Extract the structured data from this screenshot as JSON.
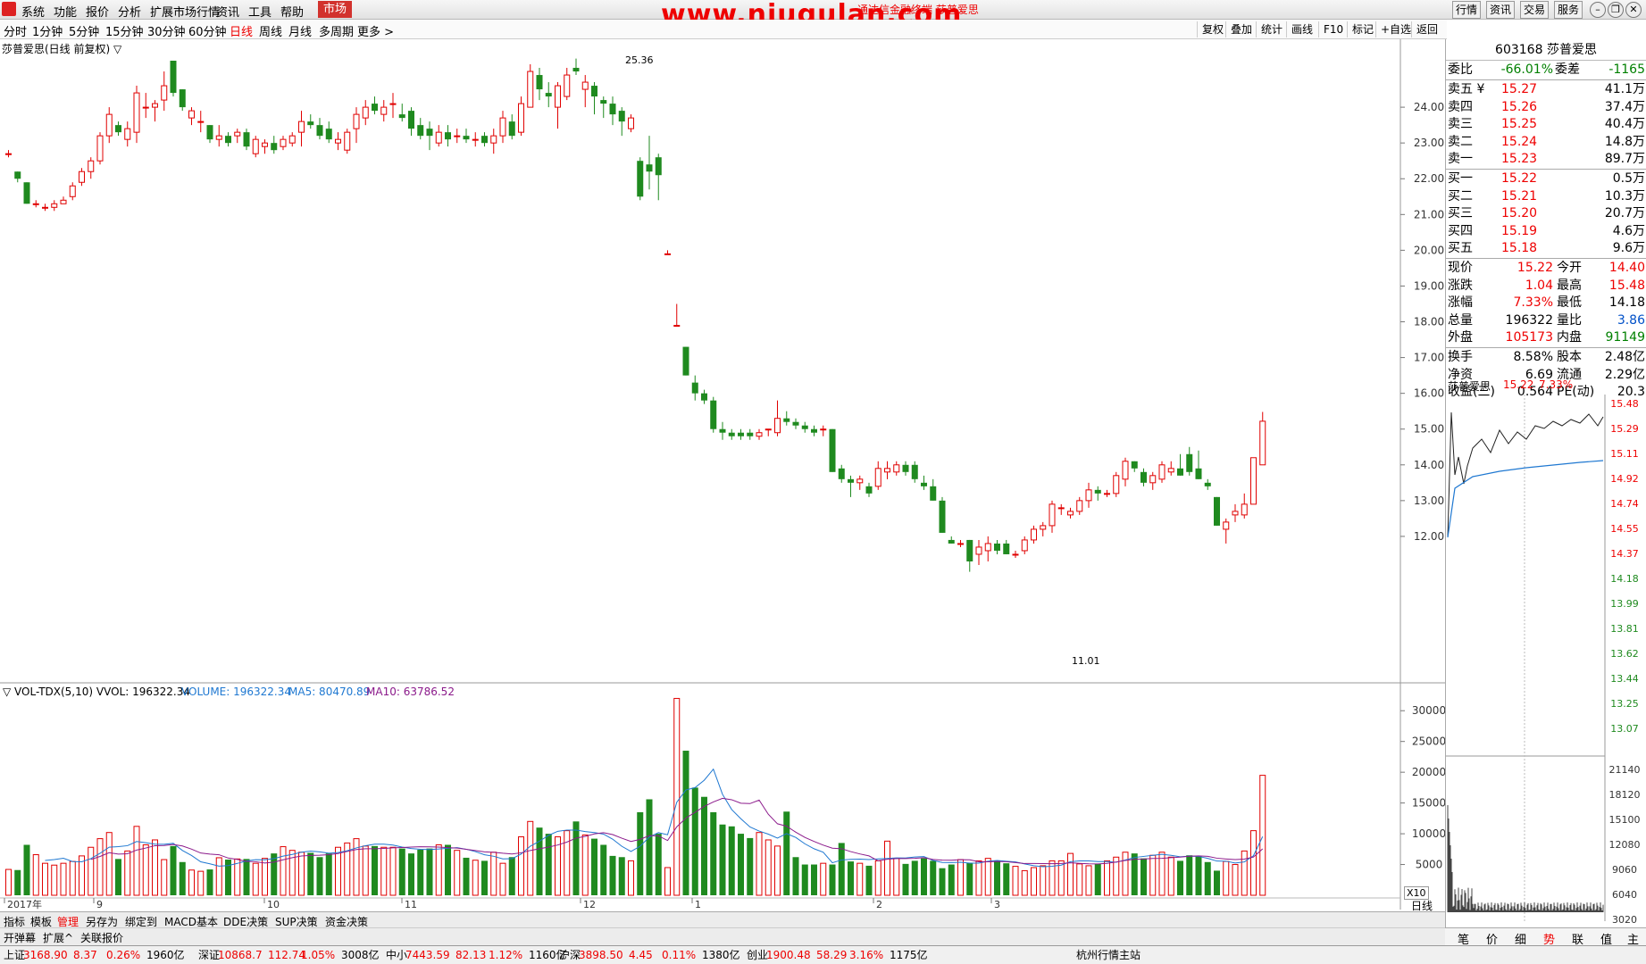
{
  "menu": [
    "系统",
    "功能",
    "报价",
    "分析",
    "扩展市场行情",
    "资讯",
    "工具",
    "帮助",
    "市场"
  ],
  "watermark": "www.niugulan.com",
  "title_partial": "通达信金融终端 莎普爱思",
  "right_buttons": [
    "行情",
    "资讯",
    "交易",
    "服务"
  ],
  "periods": [
    "分时",
    "1分钟",
    "5分钟",
    "15分钟",
    "30分钟",
    "60分钟",
    "日线",
    "周线",
    "月线",
    "多周期",
    "更多 >"
  ],
  "chart_tools": [
    "复权",
    "叠加",
    "统计",
    "画线",
    "F10",
    "标记",
    "+自选",
    "返回"
  ],
  "chart_title": "莎普爱思(日线 前复权) ▽",
  "vol_title": "▽ VOL-TDX(5,10) VVOL: 196322.34",
  "vol_legend": {
    "volume": "VOLUME: 196322.34",
    "ma5": "MA5: 80470.89",
    "ma10": "MA10: 63786.52"
  },
  "high_label": "25.36",
  "low_label": "11.01",
  "price_axis": [
    "24.00",
    "23.00",
    "22.00",
    "21.00",
    "20.00",
    "19.00",
    "18.00",
    "17.00",
    "16.00",
    "15.00",
    "14.00",
    "13.00",
    "12.00"
  ],
  "vol_axis": [
    "30000",
    "25000",
    "20000",
    "15000",
    "10000",
    "5000"
  ],
  "vol_unit": "X10",
  "date_axis": [
    {
      "label": "2017年",
      "x": 5
    },
    {
      "label": "9",
      "x": 105
    },
    {
      "label": "10",
      "x": 296
    },
    {
      "label": "11",
      "x": 450
    },
    {
      "label": "12",
      "x": 650
    },
    {
      "label": "1",
      "x": 775
    },
    {
      "label": "2",
      "x": 978
    },
    {
      "label": "3",
      "x": 1110
    }
  ],
  "period_label": "日线",
  "chart_data": {
    "type": "candlestick",
    "candles": [
      [
        22.7,
        22.8,
        22.6,
        22.7
      ],
      [
        22.2,
        22.2,
        21.9,
        22.0
      ],
      [
        21.9,
        21.9,
        21.3,
        21.3
      ],
      [
        21.3,
        21.4,
        21.2,
        21.3
      ],
      [
        21.2,
        21.3,
        21.1,
        21.2
      ],
      [
        21.2,
        21.4,
        21.1,
        21.3
      ],
      [
        21.3,
        21.5,
        21.3,
        21.4
      ],
      [
        21.5,
        21.9,
        21.4,
        21.8
      ],
      [
        21.9,
        22.3,
        21.8,
        22.2
      ],
      [
        22.2,
        22.6,
        22.0,
        22.5
      ],
      [
        22.5,
        23.3,
        22.4,
        23.2
      ],
      [
        23.2,
        24.0,
        23.0,
        23.8
      ],
      [
        23.5,
        23.6,
        23.2,
        23.3
      ],
      [
        23.1,
        23.6,
        22.9,
        23.4
      ],
      [
        23.3,
        24.6,
        23.0,
        24.4
      ],
      [
        24.0,
        24.4,
        23.7,
        24.0
      ],
      [
        24.0,
        24.2,
        23.6,
        24.1
      ],
      [
        24.2,
        25.0,
        23.9,
        24.6
      ],
      [
        25.3,
        25.3,
        24.3,
        24.4
      ],
      [
        24.5,
        24.5,
        23.9,
        24.0
      ],
      [
        23.7,
        24.0,
        23.5,
        23.9
      ],
      [
        23.6,
        23.9,
        23.3,
        23.6
      ],
      [
        23.5,
        23.5,
        23.0,
        23.1
      ],
      [
        23.1,
        23.5,
        22.9,
        23.2
      ],
      [
        23.2,
        23.3,
        22.9,
        23.0
      ],
      [
        23.2,
        23.4,
        23.0,
        23.3
      ],
      [
        23.3,
        23.4,
        22.8,
        22.9
      ],
      [
        22.7,
        23.2,
        22.6,
        23.1
      ],
      [
        22.9,
        23.1,
        22.7,
        23.0
      ],
      [
        23.0,
        23.2,
        22.7,
        22.8
      ],
      [
        22.9,
        23.2,
        22.8,
        23.1
      ],
      [
        23.0,
        23.3,
        22.9,
        23.2
      ],
      [
        23.3,
        23.9,
        22.9,
        23.6
      ],
      [
        23.6,
        23.8,
        23.4,
        23.5
      ],
      [
        23.5,
        23.7,
        23.1,
        23.2
      ],
      [
        23.4,
        23.6,
        23.0,
        23.1
      ],
      [
        23.0,
        23.3,
        22.8,
        23.1
      ],
      [
        22.8,
        23.4,
        22.7,
        23.3
      ],
      [
        23.4,
        24.0,
        23.0,
        23.8
      ],
      [
        23.7,
        24.2,
        23.5,
        24.0
      ],
      [
        24.1,
        24.3,
        23.8,
        23.9
      ],
      [
        23.8,
        24.2,
        23.6,
        24.0
      ],
      [
        24.1,
        24.4,
        23.7,
        24.1
      ],
      [
        23.8,
        24.1,
        23.6,
        23.7
      ],
      [
        23.9,
        24.0,
        23.2,
        23.4
      ],
      [
        23.5,
        23.7,
        23.1,
        23.2
      ],
      [
        23.4,
        23.6,
        22.8,
        23.2
      ],
      [
        23.0,
        23.5,
        22.9,
        23.3
      ],
      [
        23.3,
        23.5,
        22.9,
        23.1
      ],
      [
        23.2,
        23.4,
        23.0,
        23.2
      ],
      [
        23.2,
        23.4,
        23.0,
        23.1
      ],
      [
        23.1,
        23.3,
        22.9,
        23.1
      ],
      [
        23.2,
        23.3,
        22.9,
        23.0
      ],
      [
        23.0,
        23.4,
        22.7,
        23.2
      ],
      [
        23.2,
        23.9,
        23.0,
        23.7
      ],
      [
        23.6,
        23.8,
        23.1,
        23.2
      ],
      [
        23.3,
        24.3,
        23.2,
        24.1
      ],
      [
        24.0,
        25.2,
        24.0,
        25.0
      ],
      [
        24.9,
        25.1,
        24.2,
        24.5
      ],
      [
        24.4,
        24.7,
        24.0,
        24.3
      ],
      [
        24.0,
        24.7,
        23.4,
        24.6
      ],
      [
        24.3,
        25.1,
        24.2,
        24.9
      ],
      [
        25.1,
        25.36,
        24.9,
        25.0
      ],
      [
        24.5,
        24.9,
        24.0,
        24.7
      ],
      [
        24.6,
        24.7,
        23.8,
        24.3
      ],
      [
        24.2,
        24.3,
        23.7,
        24.1
      ],
      [
        24.1,
        24.3,
        23.5,
        23.8
      ],
      [
        23.9,
        24.0,
        23.2,
        23.6
      ],
      [
        23.4,
        23.8,
        23.3,
        23.7
      ],
      [
        22.5,
        22.6,
        21.4,
        21.5
      ],
      [
        22.4,
        23.2,
        21.7,
        22.2
      ],
      [
        22.6,
        22.7,
        21.4,
        22.1
      ],
      [
        19.9,
        20.0,
        19.9,
        19.9
      ],
      [
        17.9,
        18.5,
        17.9,
        17.9
      ],
      [
        17.3,
        17.3,
        16.5,
        16.5
      ],
      [
        16.3,
        16.5,
        15.8,
        16.0
      ],
      [
        16.0,
        16.1,
        15.7,
        15.8
      ],
      [
        15.8,
        15.9,
        14.9,
        15.0
      ],
      [
        15.0,
        15.2,
        14.7,
        14.9
      ],
      [
        14.9,
        15.0,
        14.7,
        14.8
      ],
      [
        14.9,
        15.0,
        14.7,
        14.8
      ],
      [
        14.9,
        15.0,
        14.7,
        14.8
      ],
      [
        14.8,
        15.0,
        14.7,
        14.9
      ],
      [
        15.0,
        15.0,
        14.8,
        15.0
      ],
      [
        14.9,
        15.8,
        14.8,
        15.3
      ],
      [
        15.3,
        15.5,
        15.1,
        15.2
      ],
      [
        15.2,
        15.3,
        15.0,
        15.1
      ],
      [
        15.1,
        15.2,
        14.9,
        15.0
      ],
      [
        15.0,
        15.1,
        14.8,
        14.9
      ],
      [
        15.0,
        15.1,
        14.8,
        15.0
      ],
      [
        15.0,
        15.0,
        13.8,
        13.8
      ],
      [
        13.9,
        14.0,
        13.5,
        13.6
      ],
      [
        13.6,
        13.7,
        13.1,
        13.5
      ],
      [
        13.5,
        13.7,
        13.3,
        13.6
      ],
      [
        13.4,
        13.5,
        13.1,
        13.2
      ],
      [
        13.4,
        14.1,
        13.3,
        13.9
      ],
      [
        13.8,
        14.1,
        13.6,
        13.9
      ],
      [
        13.8,
        14.1,
        13.7,
        14.0
      ],
      [
        14.0,
        14.1,
        13.7,
        13.8
      ],
      [
        14.0,
        14.1,
        13.5,
        13.6
      ],
      [
        13.5,
        13.7,
        13.3,
        13.4
      ],
      [
        13.4,
        13.6,
        13.0,
        13.0
      ],
      [
        13.0,
        13.1,
        12.1,
        12.1
      ],
      [
        11.9,
        12.0,
        11.8,
        11.8
      ],
      [
        11.8,
        11.9,
        11.7,
        11.8
      ],
      [
        11.9,
        11.9,
        11.01,
        11.3
      ],
      [
        11.5,
        11.9,
        11.2,
        11.7
      ],
      [
        11.6,
        12.0,
        11.3,
        11.8
      ],
      [
        11.8,
        11.9,
        11.5,
        11.6
      ],
      [
        11.8,
        11.9,
        11.5,
        11.5
      ],
      [
        11.5,
        11.6,
        11.4,
        11.5
      ],
      [
        11.6,
        12.0,
        11.5,
        11.9
      ],
      [
        11.9,
        12.3,
        11.8,
        12.2
      ],
      [
        12.2,
        12.4,
        12.0,
        12.3
      ],
      [
        12.3,
        13.0,
        12.1,
        12.9
      ],
      [
        12.8,
        12.9,
        12.6,
        12.8
      ],
      [
        12.6,
        12.8,
        12.5,
        12.7
      ],
      [
        12.7,
        13.1,
        12.6,
        13.0
      ],
      [
        13.0,
        13.5,
        12.8,
        13.3
      ],
      [
        13.3,
        13.4,
        13.0,
        13.2
      ],
      [
        13.2,
        13.3,
        13.1,
        13.2
      ],
      [
        13.2,
        13.8,
        13.1,
        13.7
      ],
      [
        13.6,
        14.2,
        13.4,
        14.1
      ],
      [
        14.1,
        14.1,
        13.8,
        13.9
      ],
      [
        13.8,
        13.9,
        13.4,
        13.5
      ],
      [
        13.5,
        13.8,
        13.3,
        13.7
      ],
      [
        13.6,
        14.1,
        13.5,
        14.0
      ],
      [
        13.8,
        14.1,
        13.7,
        13.9
      ],
      [
        13.9,
        14.3,
        13.7,
        13.7
      ],
      [
        14.3,
        14.5,
        13.7,
        13.8
      ],
      [
        13.9,
        14.4,
        13.6,
        13.6
      ],
      [
        13.5,
        13.6,
        13.3,
        13.4
      ],
      [
        13.1,
        13.1,
        12.3,
        12.3
      ],
      [
        12.2,
        12.5,
        11.8,
        12.4
      ],
      [
        12.6,
        12.9,
        12.4,
        12.7
      ],
      [
        12.6,
        13.2,
        12.5,
        12.9
      ],
      [
        12.9,
        14.2,
        12.9,
        14.2
      ],
      [
        14.0,
        15.48,
        14.0,
        15.22
      ]
    ],
    "volume": [
      420,
      410,
      820,
      660,
      520,
      490,
      520,
      550,
      640,
      780,
      920,
      1020,
      590,
      720,
      1120,
      820,
      900,
      580,
      800,
      540,
      410,
      390,
      420,
      610,
      580,
      590,
      590,
      520,
      600,
      680,
      790,
      730,
      700,
      690,
      620,
      680,
      780,
      850,
      920,
      800,
      800,
      780,
      780,
      760,
      680,
      740,
      760,
      820,
      820,
      730,
      610,
      570,
      560,
      700,
      520,
      620,
      950,
      1200,
      1100,
      1000,
      950,
      1050,
      1200,
      980,
      920,
      820,
      640,
      620,
      560,
      1350,
      1560,
      1000,
      450,
      3200,
      2350,
      1750,
      1600,
      1350,
      1150,
      1120,
      1000,
      930,
      1020,
      900,
      800,
      1360,
      620,
      500,
      500,
      520,
      500,
      850,
      550,
      520,
      480,
      560,
      880,
      600,
      510,
      560,
      600,
      560,
      440,
      500,
      580,
      530,
      560,
      600,
      560,
      520,
      470,
      400,
      450,
      480,
      560,
      560,
      680,
      510,
      480,
      510,
      560,
      620,
      700,
      680,
      600,
      650,
      700,
      620,
      560,
      650,
      630,
      540,
      400,
      550,
      500,
      720,
      1050,
      1950
    ],
    "xlim": [
      "2017年",
      "3"
    ],
    "price_range": [
      11.01,
      25.36
    ]
  },
  "quote": {
    "code_name": "603168 莎普爱思",
    "weibi_label": "委比",
    "weibi": "-66.01%",
    "weicha_label": "委差",
    "weicha": "-1165",
    "sells": [
      {
        "label": "卖五 ¥",
        "price": "15.27",
        "vol": "41.1万"
      },
      {
        "label": "卖四",
        "price": "15.26",
        "vol": "37.4万"
      },
      {
        "label": "卖三",
        "price": "15.25",
        "vol": "40.4万"
      },
      {
        "label": "卖二",
        "price": "15.24",
        "vol": "14.8万"
      },
      {
        "label": "卖一",
        "price": "15.23",
        "vol": "89.7万"
      }
    ],
    "buys": [
      {
        "label": "买一",
        "price": "15.22",
        "vol": "0.5万"
      },
      {
        "label": "买二",
        "price": "15.21",
        "vol": "10.3万"
      },
      {
        "label": "买三",
        "price": "15.20",
        "vol": "20.7万"
      },
      {
        "label": "买四",
        "price": "15.19",
        "vol": "4.6万"
      },
      {
        "label": "买五",
        "price": "15.18",
        "vol": "9.6万"
      }
    ],
    "stats": [
      {
        "l1": "现价",
        "v1": "15.22",
        "c1": "red",
        "l2": "今开",
        "v2": "14.40",
        "c2": "red"
      },
      {
        "l1": "涨跌",
        "v1": "1.04",
        "c1": "red",
        "l2": "最高",
        "v2": "15.48",
        "c2": "red"
      },
      {
        "l1": "涨幅",
        "v1": "7.33%",
        "c1": "red",
        "l2": "最低",
        "v2": "14.18",
        "c2": ""
      },
      {
        "l1": "总量",
        "v1": "196322",
        "c1": "",
        "l2": "量比",
        "v2": "3.86",
        "c2": "blu"
      },
      {
        "l1": "外盘",
        "v1": "105173",
        "c1": "red",
        "l2": "内盘",
        "v2": "91149",
        "c2": "grn"
      }
    ],
    "stats2": [
      {
        "l1": "换手",
        "v1": "8.58%",
        "l2": "股本",
        "v2": "2.48亿"
      },
      {
        "l1": "净资",
        "v1": "6.69",
        "l2": "流通",
        "v2": "2.29亿"
      },
      {
        "l1": "收益(三)",
        "v1": "0.564",
        "l2": "PE(动)",
        "v2": "20.3"
      }
    ]
  },
  "mini": {
    "title": "莎普爱思",
    "price": "15.22",
    "pct": "7.33%",
    "price_axis": [
      "15.48",
      "15.29",
      "15.11",
      "14.92",
      "14.74",
      "14.55",
      "14.37",
      "14.18",
      "13.99",
      "13.81",
      "13.62",
      "13.44",
      "13.25",
      "13.07"
    ],
    "vol_axis": [
      "21140",
      "18120",
      "15100",
      "12080",
      "9060",
      "6040",
      "3020"
    ],
    "tabs": [
      "笔",
      "价",
      "细",
      "势",
      "联",
      "值",
      "主"
    ]
  },
  "bottom_tabs": [
    "指标",
    "模板",
    "管理",
    "另存为",
    "绑定到",
    "MACD基本",
    "DDE决策",
    "SUP决策",
    "资金决策"
  ],
  "bottom_tabs2": [
    "开弹幕",
    "扩展^",
    "关联报价"
  ],
  "status": [
    {
      "name": "上证",
      "v": "3168.90",
      "c": "8.37",
      "p": "0.26%",
      "a": "1960亿"
    },
    {
      "name": "深证",
      "v": "10868.7",
      "c": "112.74",
      "p": "1.05%",
      "a": "3008亿"
    },
    {
      "name": "中小",
      "v": "7443.59",
      "c": "82.13",
      "p": "1.12%",
      "a": "1160亿"
    },
    {
      "name": "沪深",
      "v": "3898.50",
      "c": "4.45",
      "p": "0.11%",
      "a": "1380亿"
    },
    {
      "name": "创业",
      "v": "1900.48",
      "c": "58.29",
      "p": "3.16%",
      "a": "1175亿"
    }
  ],
  "status_site": "杭州行情主站",
  "colors": {
    "up": "#e00000",
    "down": "#1f8a1f",
    "ma5": "#1f78d1",
    "ma10": "#8b1a8b"
  }
}
